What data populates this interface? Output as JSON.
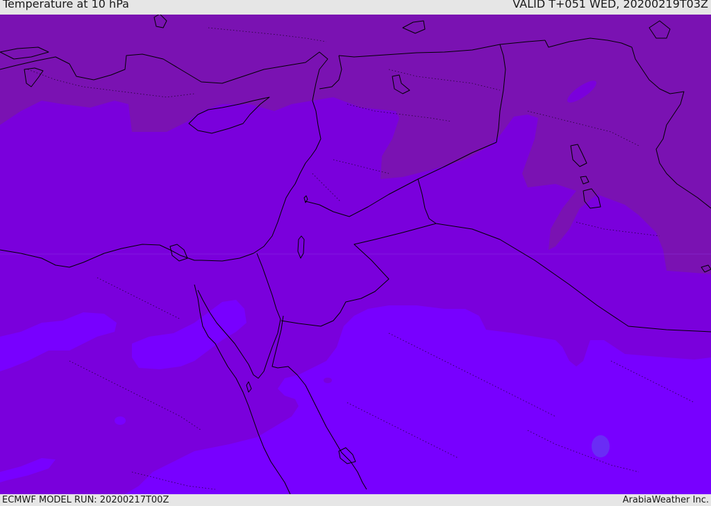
{
  "header": {
    "title": "Temperature at 10 hPa",
    "valid_time": "VALID T+051 WED, 20200219T03Z"
  },
  "footer": {
    "model_run": "ECMWF MODEL RUN: 20200217T00Z",
    "credit": "ArabiaWeather Inc."
  },
  "colors": {
    "band_warm": "#7a12b2",
    "band_mid": "#7a00dc",
    "band_cool": "#7800ff",
    "spot_cool": "#6a2cf5",
    "coastline": "#000000"
  }
}
